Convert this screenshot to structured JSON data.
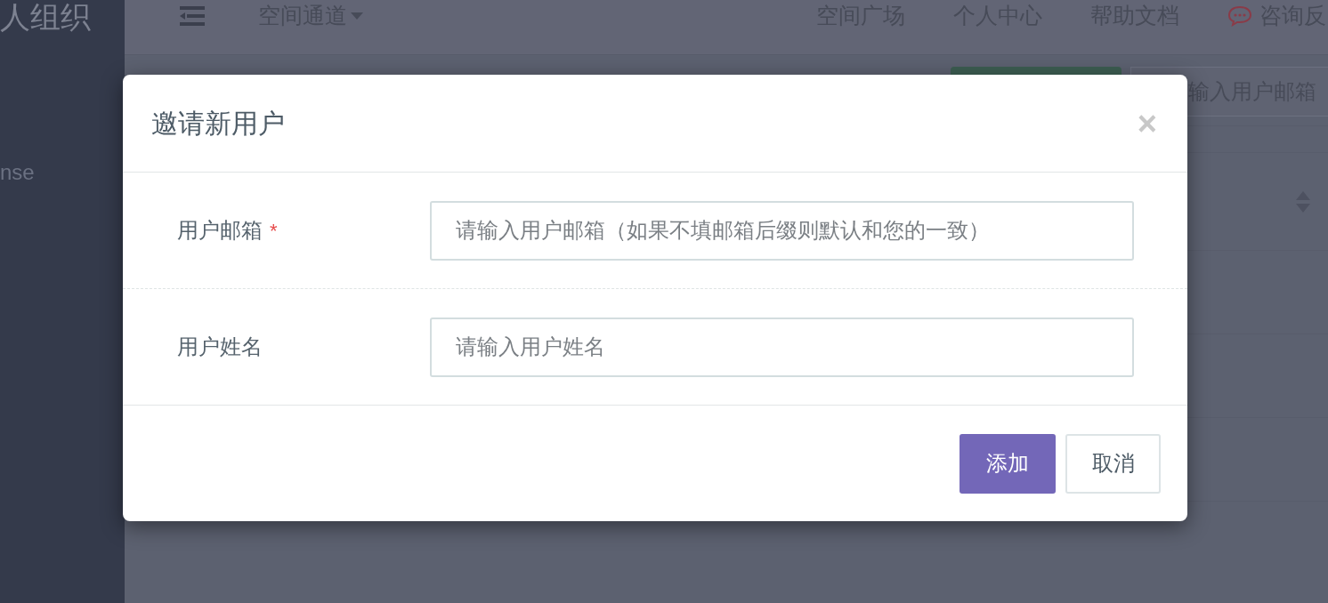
{
  "sidebar": {
    "title": "人组织",
    "items": [
      {
        "label": "nse"
      }
    ]
  },
  "top_bar": {
    "menu": {
      "label": "空间通道"
    },
    "links": [
      {
        "label": "空间广场"
      },
      {
        "label": "个人中心"
      },
      {
        "label": "帮助文档"
      }
    ],
    "feedback": {
      "label": "咨询反"
    }
  },
  "page": {
    "search": {
      "placeholder": "输入用户邮箱"
    }
  },
  "dialog": {
    "title": "邀请新用户",
    "close": "×",
    "fields": [
      {
        "label": "用户邮箱",
        "required_mark": "*",
        "placeholder": "请输入用户邮箱（如果不填邮箱后缀则默认和您的一致）"
      },
      {
        "label": "用户姓名",
        "placeholder": "请输入用户姓名"
      }
    ],
    "buttons": [
      {
        "label": "添加",
        "kind": "primary"
      },
      {
        "label": "取消",
        "kind": "default"
      }
    ]
  }
}
